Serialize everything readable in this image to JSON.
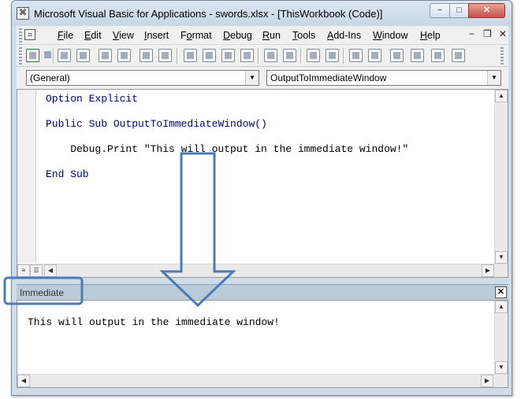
{
  "window": {
    "title": "Microsoft Visual Basic for Applications - swords.xlsx - [ThisWorkbook (Code)]",
    "minimize_glyph": "−",
    "maximize_glyph": "□",
    "close_glyph": "✕"
  },
  "menubar": {
    "items": [
      {
        "pre": "",
        "ul": "F",
        "post": "ile"
      },
      {
        "pre": "",
        "ul": "E",
        "post": "dit"
      },
      {
        "pre": "",
        "ul": "V",
        "post": "iew"
      },
      {
        "pre": "",
        "ul": "I",
        "post": "nsert"
      },
      {
        "pre": "F",
        "ul": "o",
        "post": "rmat"
      },
      {
        "pre": "",
        "ul": "D",
        "post": "ebug"
      },
      {
        "pre": "",
        "ul": "R",
        "post": "un"
      },
      {
        "pre": "",
        "ul": "T",
        "post": "ools"
      },
      {
        "pre": "",
        "ul": "A",
        "post": "dd-Ins"
      },
      {
        "pre": "",
        "ul": "W",
        "post": "indow"
      },
      {
        "pre": "",
        "ul": "H",
        "post": "elp"
      }
    ],
    "doc_minimize": "−",
    "doc_restore": "❐",
    "doc_close": "✕"
  },
  "combos": {
    "object": "(General)",
    "procedure": "OutputToImmediateWindow"
  },
  "code": {
    "line1_kw": "Option Explicit",
    "line2_kw": "Public Sub",
    "line2_name": " OutputToImmediateWindow()",
    "line3": "    Debug.Print \"This will output in the immediate window!\"",
    "line4_kw": "End Sub"
  },
  "immediate": {
    "title": "Immediate",
    "output": "This will output in the immediate window!",
    "close_glyph": "✕"
  },
  "colors": {
    "keyword": "#00008b",
    "annotation": "#4a7bb7"
  }
}
